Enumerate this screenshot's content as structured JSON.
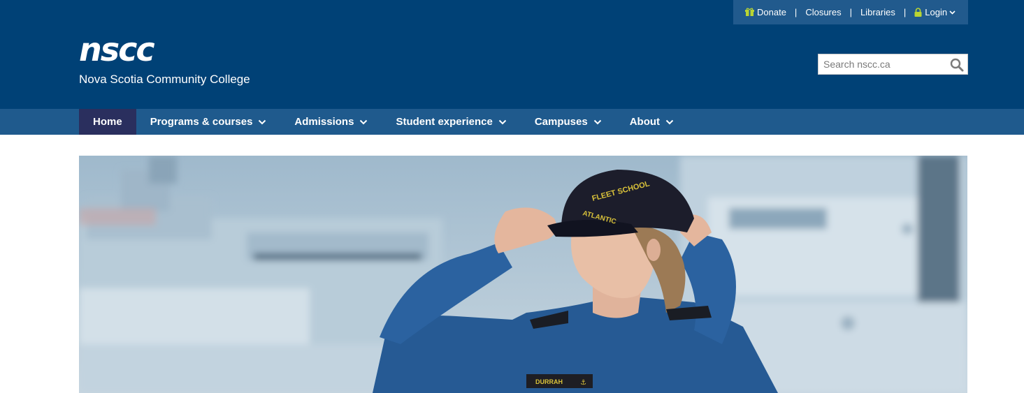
{
  "utility_nav": {
    "donate": "Donate",
    "separator": "|",
    "closures": "Closures",
    "libraries": "Libraries",
    "login": "Login"
  },
  "brand": {
    "logo_text": "nscc",
    "name": "Nova Scotia Community College"
  },
  "search": {
    "placeholder": "Search nscc.ca"
  },
  "main_nav": [
    {
      "label": "Home",
      "active": true
    },
    {
      "label": "Programs & courses"
    },
    {
      "label": "Admissions"
    },
    {
      "label": "Student experience"
    },
    {
      "label": "Campuses"
    },
    {
      "label": "About"
    }
  ],
  "hero": {
    "cap_text": "FLEET SCHOOL ATLANTIC",
    "name_tag": "DURRAH"
  },
  "colors": {
    "header_bg": "#004176",
    "nav_bg": "#1f5a8d",
    "nav_active": "#2a2f5e",
    "accent_icon": "#b9d532"
  },
  "icons": [
    "gift-icon",
    "lock-icon",
    "chevron-down-icon",
    "search-icon"
  ]
}
